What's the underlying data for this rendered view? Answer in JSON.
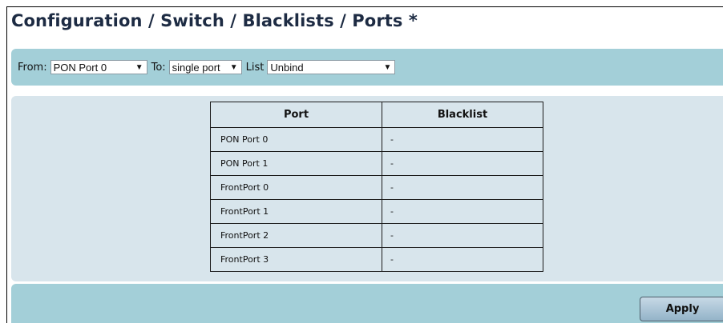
{
  "page": {
    "title": "Configuration / Switch / Blacklists / Ports *"
  },
  "filters": {
    "from_label": "From:",
    "from_value": "PON Port 0",
    "to_label": "To:",
    "to_value": "single port",
    "list_label": "List",
    "list_value": "Unbind",
    "arrow_glyph": "▼"
  },
  "table": {
    "headers": [
      "Port",
      "Blacklist"
    ],
    "rows": [
      {
        "port": "PON Port 0",
        "blacklist": "-"
      },
      {
        "port": "PON Port 1",
        "blacklist": "-"
      },
      {
        "port": "FrontPort 0",
        "blacklist": "-"
      },
      {
        "port": "FrontPort 1",
        "blacklist": "-"
      },
      {
        "port": "FrontPort 2",
        "blacklist": "-"
      },
      {
        "port": "FrontPort 3",
        "blacklist": "-"
      }
    ]
  },
  "footer": {
    "apply_label": "Apply"
  },
  "colors": {
    "bar": "#a3cfd8",
    "content": "#d8e5ec",
    "title": "#1d2b43"
  }
}
